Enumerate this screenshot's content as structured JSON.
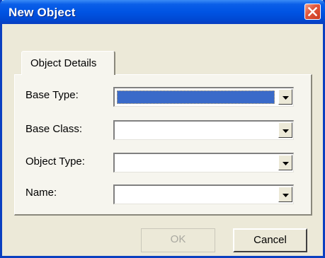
{
  "window": {
    "title": "New Object"
  },
  "tabs": [
    {
      "label": "Object Details"
    }
  ],
  "fields": [
    {
      "label": "Base Type:",
      "value": ""
    },
    {
      "label": "Base Class:",
      "value": ""
    },
    {
      "label": "Object Type:",
      "value": ""
    },
    {
      "label": "Name:",
      "value": ""
    }
  ],
  "buttons": {
    "ok_label": "OK",
    "cancel_label": "Cancel"
  },
  "colors": {
    "titlebar": "#0054e3",
    "close": "#e2583e",
    "selection": "#3a6ac9",
    "dialog_bg": "#ece9d8"
  },
  "icons": {
    "close": "close-icon",
    "dropdown": "chevron-down-icon"
  }
}
